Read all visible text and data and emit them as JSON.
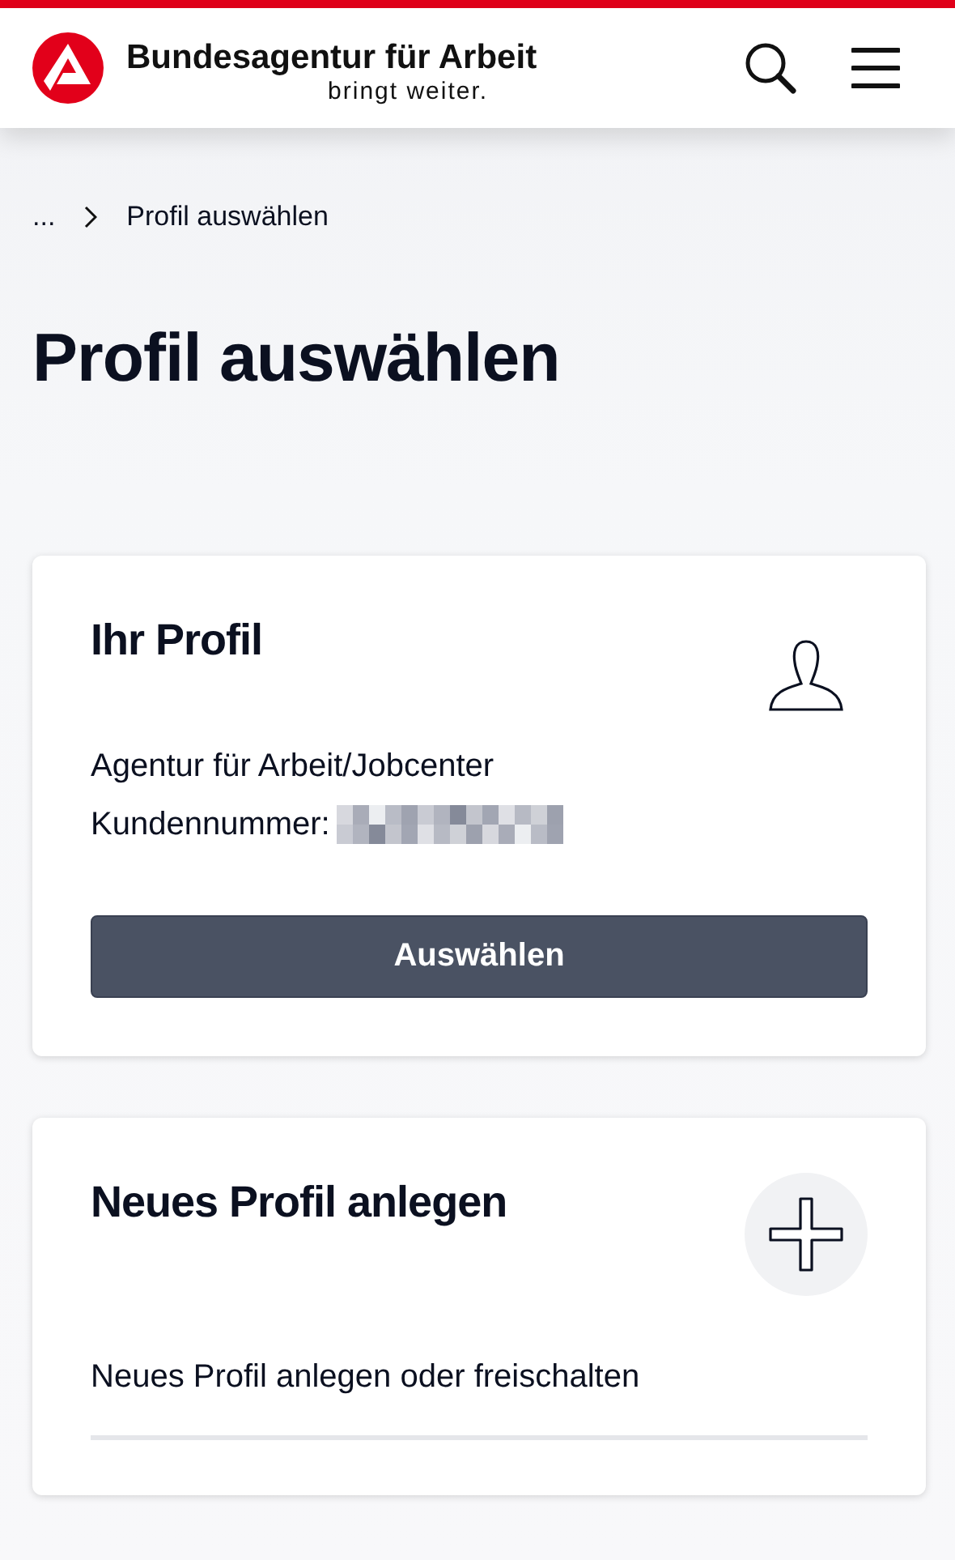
{
  "header": {
    "logo_title": "Bundesagentur für Arbeit",
    "logo_tagline": "bringt weiter."
  },
  "breadcrumb": [
    {
      "label": "..."
    },
    {
      "label": "Profil auswählen"
    }
  ],
  "page_title": "Profil auswählen",
  "cards": [
    {
      "kind": "profile",
      "title": "Ihr Profil",
      "lines": [
        "Agentur für Arbeit/Jobcenter",
        "Kundennummer:"
      ],
      "button": "Auswählen"
    },
    {
      "kind": "new",
      "title": "Neues Profil anlegen",
      "link": "Neues Profil anlegen oder freischalten"
    }
  ]
}
